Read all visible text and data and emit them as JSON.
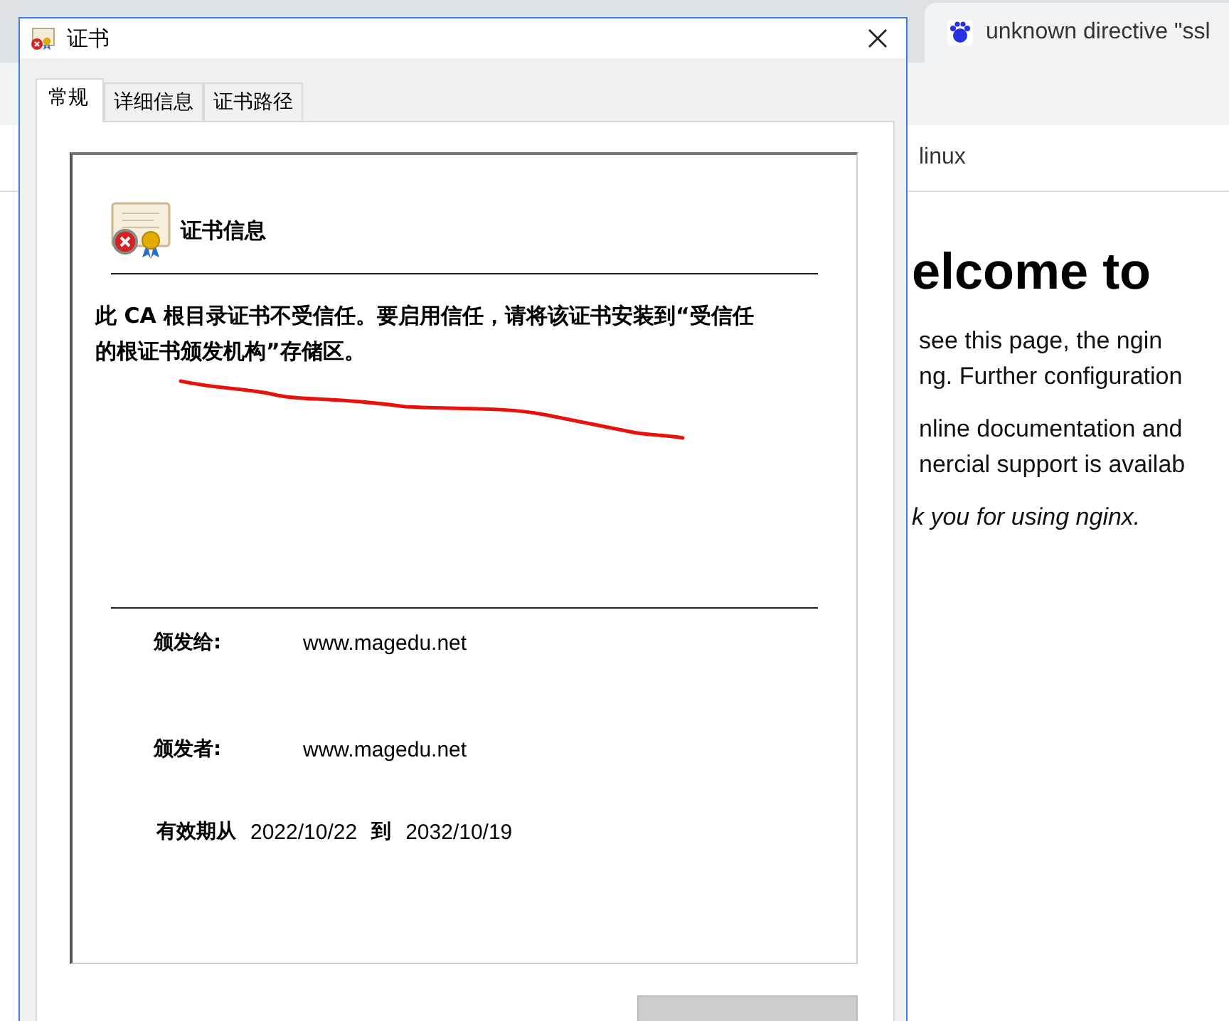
{
  "browser": {
    "tab": {
      "title": "unknown directive \"ssl"
    },
    "bookmarks": [
      "linux"
    ],
    "page": {
      "heading": "elcome to",
      "paragraphs": [
        [
          "see this page, the ngin",
          "ng. Further configuration"
        ],
        [
          "nline documentation and",
          "nercial support is availab"
        ]
      ],
      "closing": "k you for using nginx."
    }
  },
  "dialog": {
    "title": "证书",
    "tabs": [
      {
        "label": "常规",
        "selected": true
      },
      {
        "label": "详细信息",
        "selected": false
      },
      {
        "label": "证书路径",
        "selected": false
      }
    ],
    "info_heading": "证书信息",
    "message": "此 CA 根目录证书不受信任。要启用信任，请将该证书安装到“受信任的根证书颁发机构”存储区。",
    "fields": [
      {
        "label": "颁发给:",
        "value": "www.magedu.net"
      },
      {
        "label": "颁发者:",
        "value": "www.magedu.net"
      }
    ],
    "validity": {
      "from_label": "有效期从",
      "from": "2022/10/22",
      "to_label": "到",
      "to": "2032/10/19"
    },
    "issuer_statement_button": {
      "disabled": true
    }
  }
}
